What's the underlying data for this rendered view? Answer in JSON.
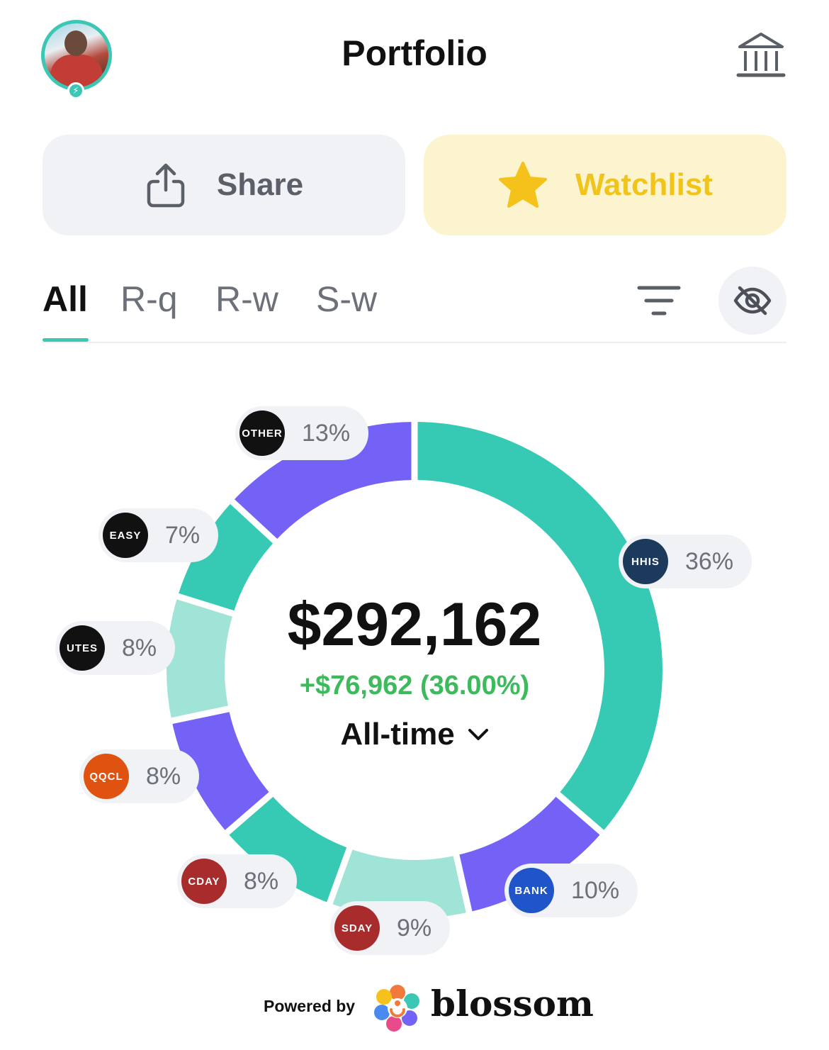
{
  "header": {
    "title": "Portfolio"
  },
  "actions": {
    "share_label": "Share",
    "watchlist_label": "Watchlist"
  },
  "tabs": [
    {
      "label": "All",
      "active": true
    },
    {
      "label": "R-q",
      "active": false
    },
    {
      "label": "R-w",
      "active": false
    },
    {
      "label": "S-w",
      "active": false
    }
  ],
  "summary": {
    "total_value": "$292,162",
    "gain": "+$76,962 (36.00%)",
    "range": "All-time"
  },
  "holdings": [
    {
      "ticker": "HHIS",
      "pct_label": "36%",
      "badge_color": "#1b3a5c"
    },
    {
      "ticker": "BANK",
      "pct_label": "10%",
      "badge_color": "#1f55c9"
    },
    {
      "ticker": "SDAY",
      "pct_label": "9%",
      "badge_color": "#a82c2c"
    },
    {
      "ticker": "CDAY",
      "pct_label": "8%",
      "badge_color": "#a82c2c"
    },
    {
      "ticker": "QQCL",
      "pct_label": "8%",
      "badge_color": "#e0520f"
    },
    {
      "ticker": "UTES",
      "pct_label": "8%",
      "badge_color": "#111111"
    },
    {
      "ticker": "EASY",
      "pct_label": "7%",
      "badge_color": "#111111"
    },
    {
      "ticker": "OTHER",
      "pct_label": "13%",
      "badge_color": "#111111"
    }
  ],
  "chart_data": {
    "type": "pie",
    "categories": [
      "HHIS",
      "BANK",
      "SDAY",
      "CDAY",
      "QQCL",
      "UTES",
      "EASY",
      "OTHER"
    ],
    "values": [
      36,
      10,
      9,
      8,
      8,
      8,
      7,
      13
    ],
    "colors": [
      "#36c9b4",
      "#7362f5",
      "#a0e4d8",
      "#36c9b4",
      "#7362f5",
      "#a0e4d8",
      "#36c9b4",
      "#7362f5"
    ]
  },
  "footer": {
    "powered_by": "Powered by",
    "brand": "blossom"
  },
  "icons": {
    "avatar": "profile-avatar",
    "bank": "bank-icon",
    "share": "share-icon",
    "watchlist": "star-icon",
    "filter": "filter-icon",
    "privacy": "eye-off-icon",
    "range": "chevron-down-icon"
  }
}
